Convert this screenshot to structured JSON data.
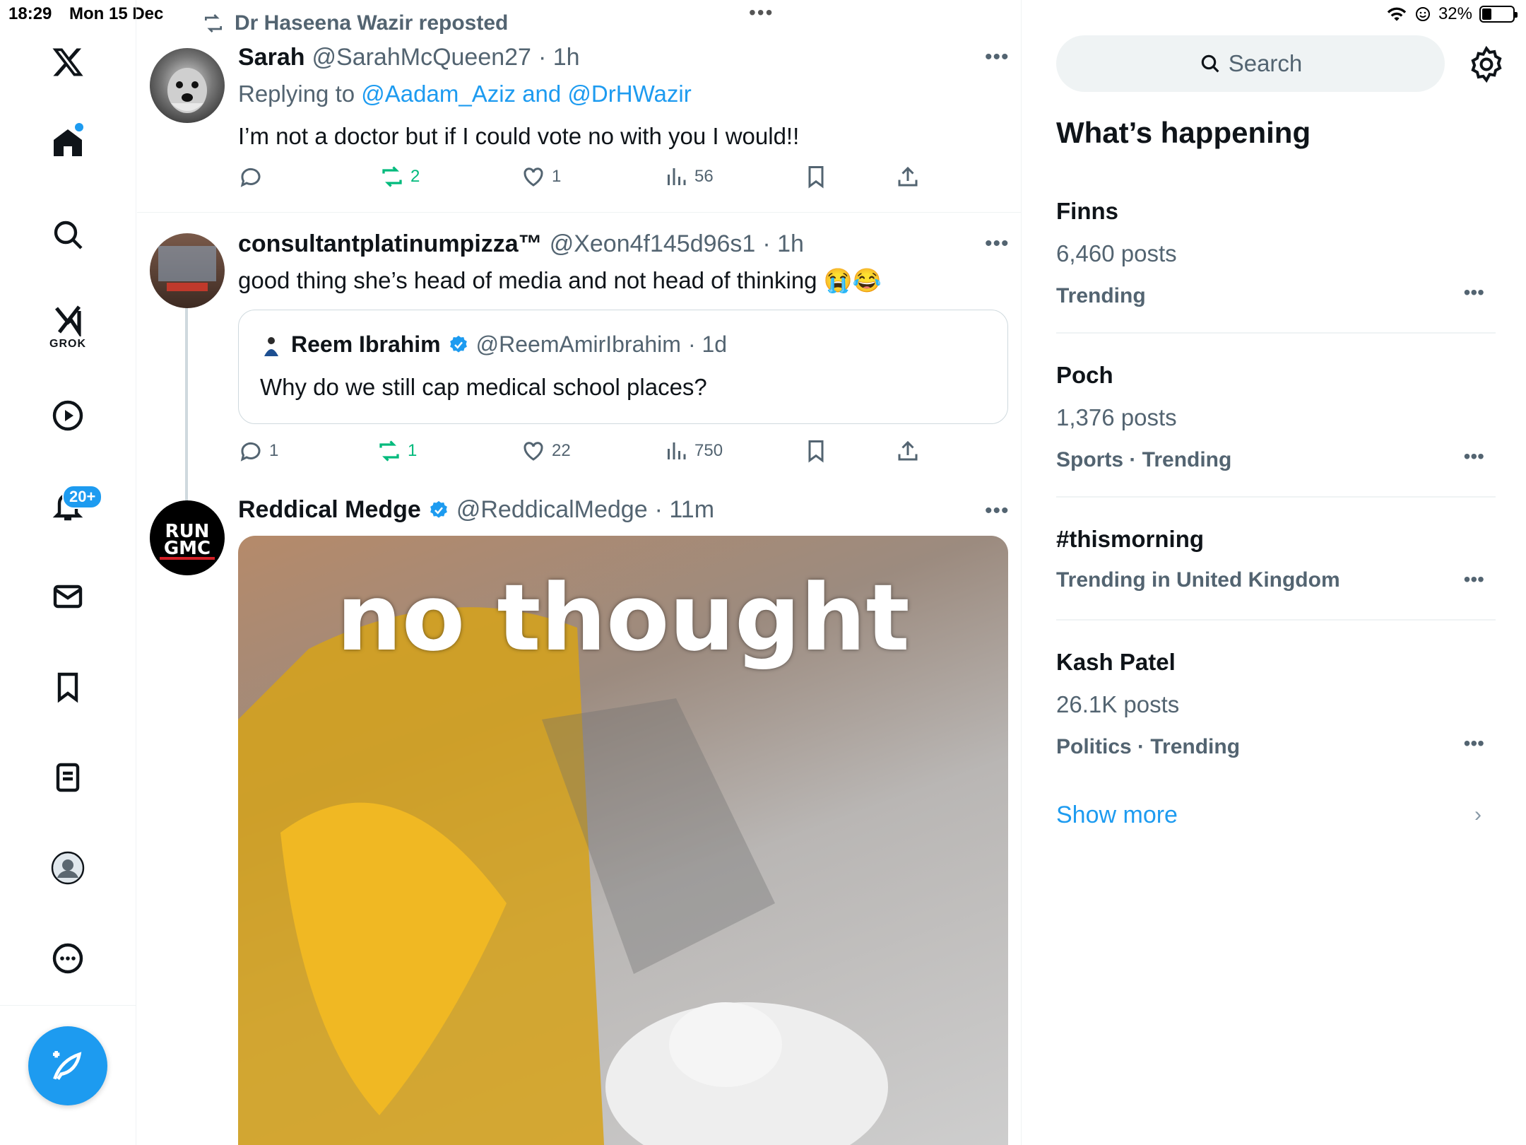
{
  "status_bar": {
    "time": "18:29",
    "date": "Mon 15 Dec",
    "battery": "32%",
    "battery_level": 0.32
  },
  "nav": {
    "notifications_badge": "20+",
    "grok_label": "GROK"
  },
  "feed": {
    "repost_line": "Dr Haseena Wazir reposted",
    "tweets": [
      {
        "name": "Sarah",
        "handle": "@SarahMcQueen27",
        "time": "· 1h",
        "replying_prefix": "Replying to",
        "replying_to": "@Aadam_Aziz and @DrHWazir",
        "text": "I’m not a doctor but if I could vote no with you I would!!",
        "replies": "",
        "reposts": "2",
        "likes": "1",
        "views": "56"
      },
      {
        "name": "consultantplatinumpizza™",
        "handle": "@Xeon4f145d96s1",
        "time": "· 1h",
        "text": "good thing she’s head of media and not head of thinking 😭😂",
        "avatar_text": "General Medical Council · NO CONFIDENCE",
        "quote": {
          "name": "Reem Ibrahim",
          "handle": "@ReemAmirIbrahim",
          "time": "· 1d",
          "text": "Why do we still cap medical school places?"
        },
        "replies": "1",
        "reposts": "1",
        "likes": "22",
        "views": "750"
      },
      {
        "name": "Reddical Medge",
        "handle": "@ReddicalMedge",
        "time": "· 11m",
        "avatar_text": "RUN GMC",
        "media_caption": "no thought"
      }
    ]
  },
  "sidebar": {
    "search_placeholder": "Search",
    "section_title": "What’s happening",
    "trends": [
      {
        "name": "Finns",
        "count": "6,460 posts",
        "context": "Trending"
      },
      {
        "name": "Poch",
        "count": "1,376 posts",
        "context": "Sports · Trending"
      },
      {
        "name": "#thismorning",
        "count": "",
        "context": "Trending in United Kingdom"
      },
      {
        "name": "Kash Patel",
        "count": "26.1K posts",
        "context": "Politics · Trending"
      }
    ],
    "show_more": "Show more"
  },
  "colors": {
    "accent": "#1d9bf0",
    "repost_green": "#00ba7c",
    "secondary_text": "#536471"
  }
}
